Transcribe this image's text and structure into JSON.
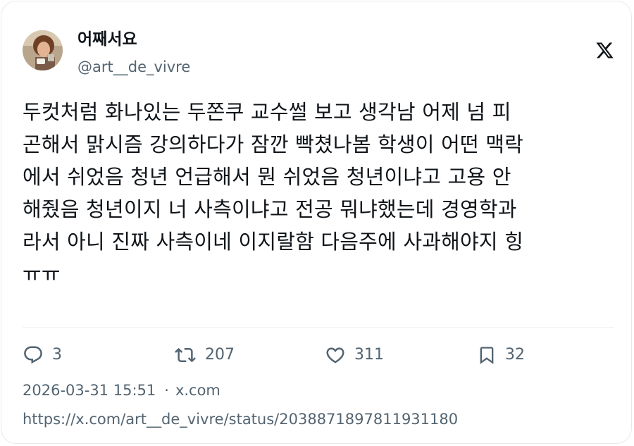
{
  "author": {
    "display_name": "어째서요",
    "handle": "@art__de_vivre"
  },
  "logo": {
    "icon": "x-logo-icon"
  },
  "tweet": {
    "lines": [
      "두컷처럼 화나있는 두쫀쿠 교수썰 보고 생각남 어제 넘 피",
      "곤해서 맑시즘 강의하다가 잠깐 빡쳤나봄 학생이 어떤 맥락",
      "에서 쉬었음 청년 언급해서 뭔 쉬었음 청년이냐고 고용 안",
      "해줬음 청년이지 너 사측이냐고 전공 뭐냐했는데 경영학과",
      "라서 아니 진짜 사측이네 이지랄함 다음주에 사과해야지 힝",
      "ㅠㅠ"
    ]
  },
  "actions": {
    "reply": {
      "icon": "reply-icon",
      "count": "3"
    },
    "retweet": {
      "icon": "retweet-icon",
      "count": "207"
    },
    "like": {
      "icon": "heart-icon",
      "count": "311"
    },
    "bookmark": {
      "icon": "bookmark-icon",
      "count": "32"
    }
  },
  "meta": {
    "timestamp": "2026-03-31 15:51",
    "separator": "·",
    "source": "x.com"
  },
  "status_url": "https://x.com/art__de_vivre/status/2038871897811931180",
  "colors": {
    "text": "#0f1419",
    "secondary": "#536471",
    "border": "#e6e9ec"
  }
}
